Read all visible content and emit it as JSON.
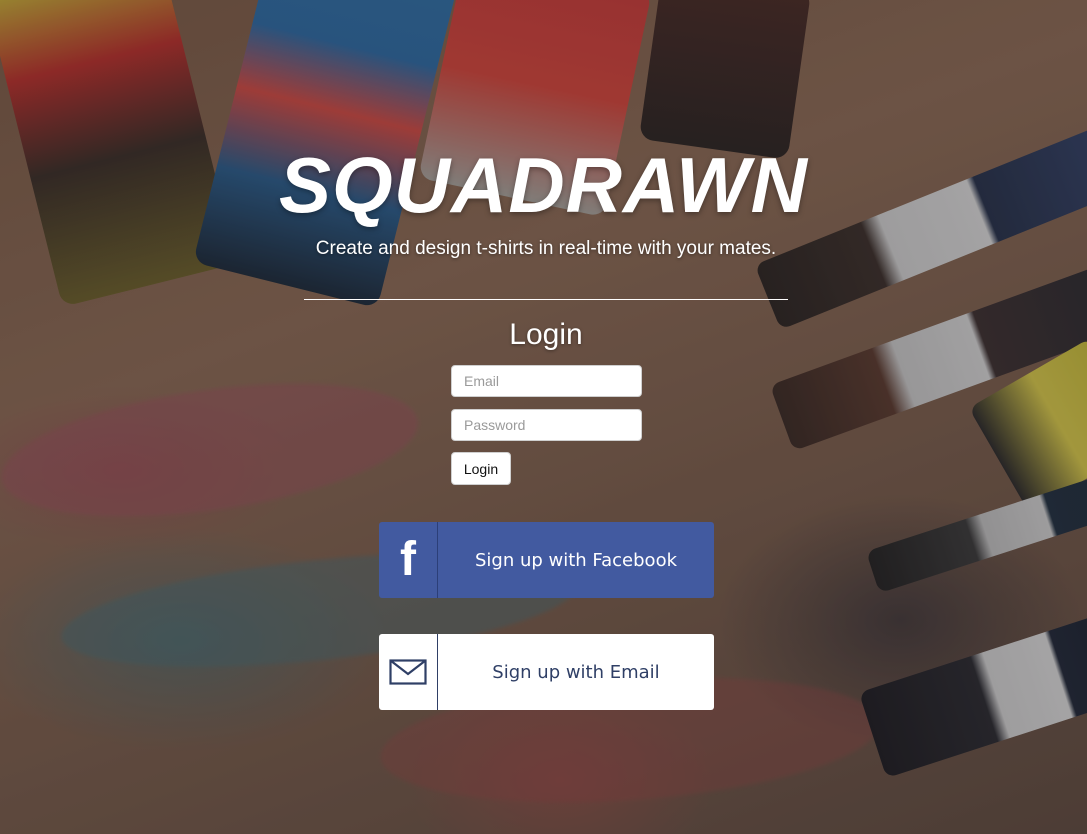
{
  "brand": {
    "logo": "SQUADRAWN",
    "tagline": "Create and design t-shirts in real-time with your mates."
  },
  "login": {
    "title": "Login",
    "email_placeholder": "Email",
    "password_placeholder": "Password",
    "submit_label": "Login"
  },
  "signup": {
    "facebook": {
      "icon": "facebook-icon",
      "icon_glyph": "f",
      "label": "Sign up with Facebook",
      "color": "#425aa0"
    },
    "email": {
      "icon": "envelope-icon",
      "label": "Sign up with Email",
      "color": "#2f3f66"
    }
  }
}
